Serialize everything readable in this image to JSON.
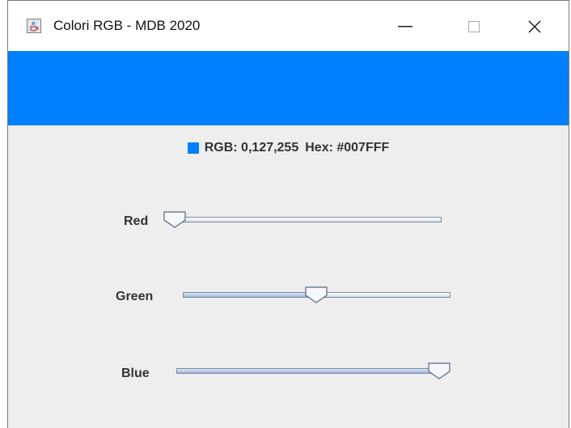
{
  "window": {
    "title": "Colori RGB - MDB 2020",
    "app_icon": "java-cup-icon",
    "controls": [
      "minimize-icon",
      "maximize-icon",
      "close-icon"
    ]
  },
  "preview": {
    "color": "#007FFF"
  },
  "info": {
    "rgb_text": "RGB: 0,127,255",
    "hex_text": "Hex: #007FFF"
  },
  "sliders": {
    "red": {
      "label": "Red",
      "value": 0,
      "max": 255
    },
    "green": {
      "label": "Green",
      "value": 127,
      "max": 255
    },
    "blue": {
      "label": "Blue",
      "value": 255,
      "max": 255
    }
  }
}
